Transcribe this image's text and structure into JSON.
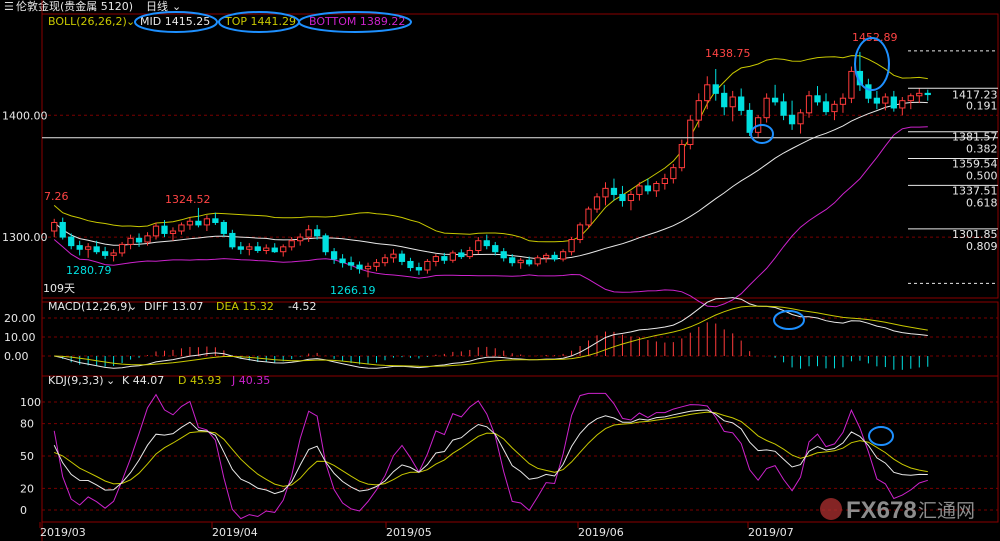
{
  "header": {
    "instrument": "伦敦金现(贵金属 5120)",
    "period": "日线",
    "period_chevron_icon": "chevron-down-icon"
  },
  "colors": {
    "up": "#ff3b3b",
    "down": "#00e0e0",
    "boll_mid": "#e8e8e8",
    "boll_top": "#c8c800",
    "boll_bottom": "#cc22cc",
    "macd_diff": "#e8e8e8",
    "macd_dea": "#c8c800",
    "kdj_k": "#e8e8e8",
    "kdj_d": "#c8c800",
    "kdj_j": "#cc22cc",
    "grid": "#7a0000",
    "highlight": "#1e90ff"
  },
  "boll": {
    "label": "BOLL(26,26,2)",
    "mid": "MID 1415.25",
    "top": "TOP 1441.29",
    "bottom": "BOTTOM 1389.22"
  },
  "macd": {
    "label": "MACD(12,26,9)",
    "diff": "DIFF 13.07",
    "dea": "DEA 15.32",
    "macd": "-4.52"
  },
  "kdj": {
    "label": "KDJ(9,3,3)",
    "k": "K 44.07",
    "d": "D 45.93",
    "j": "J 40.35"
  },
  "price_axis": {
    "labels": [
      "1400.00",
      "1300.00"
    ]
  },
  "fib_levels": [
    {
      "price": "1381.57",
      "ratio": "0.382"
    },
    {
      "price": "1359.54",
      "ratio": "0.500"
    },
    {
      "price": "1337.51",
      "ratio": "0.618"
    },
    {
      "price": "1301.85",
      "ratio": "0.809"
    }
  ],
  "right_labels": {
    "last_price": "1417.23",
    "ratio_top": "0.191"
  },
  "annotations": {
    "a1": "7.26",
    "a2": "1324.52",
    "a3": "1280.79",
    "a4": "1266.19",
    "a5": "1438.75",
    "a6": "1452.89",
    "days": "109天"
  },
  "macd_axis": [
    "20.00",
    "10.00",
    "0.00"
  ],
  "kdj_axis": [
    "100",
    "80",
    "50",
    "20",
    "0"
  ],
  "x_axis": [
    "2019/03",
    "2019/04",
    "2019/05",
    "2019/06",
    "2019/07"
  ],
  "watermark": {
    "brand": "FX678",
    "cn": "汇通网"
  },
  "chart_data": {
    "type": "candlestick",
    "instrument": "伦敦金现",
    "period": "日线",
    "x_ticks": [
      "2019/03",
      "2019/04",
      "2019/05",
      "2019/06",
      "2019/07"
    ],
    "candles": [
      [
        1305,
        1315,
        1300,
        1312
      ],
      [
        1312,
        1316,
        1298,
        1300
      ],
      [
        1300,
        1303,
        1290,
        1293
      ],
      [
        1293,
        1297,
        1285,
        1290
      ],
      [
        1290,
        1295,
        1283,
        1292
      ],
      [
        1292,
        1297,
        1286,
        1288
      ],
      [
        1288,
        1292,
        1282,
        1285
      ],
      [
        1285,
        1290,
        1280,
        1287
      ],
      [
        1287,
        1296,
        1284,
        1294
      ],
      [
        1294,
        1302,
        1290,
        1299
      ],
      [
        1299,
        1303,
        1292,
        1296
      ],
      [
        1296,
        1304,
        1293,
        1301
      ],
      [
        1301,
        1312,
        1298,
        1309
      ],
      [
        1309,
        1314,
        1300,
        1303
      ],
      [
        1303,
        1308,
        1297,
        1305
      ],
      [
        1305,
        1312,
        1302,
        1310
      ],
      [
        1310,
        1316,
        1306,
        1313
      ],
      [
        1313,
        1324,
        1308,
        1310
      ],
      [
        1310,
        1318,
        1305,
        1315
      ],
      [
        1315,
        1320,
        1310,
        1312
      ],
      [
        1312,
        1314,
        1300,
        1303
      ],
      [
        1303,
        1306,
        1290,
        1292
      ],
      [
        1292,
        1296,
        1286,
        1290
      ],
      [
        1290,
        1295,
        1285,
        1292
      ],
      [
        1292,
        1296,
        1287,
        1289
      ],
      [
        1289,
        1294,
        1286,
        1291
      ],
      [
        1291,
        1295,
        1287,
        1288
      ],
      [
        1288,
        1294,
        1284,
        1292
      ],
      [
        1292,
        1300,
        1289,
        1297
      ],
      [
        1297,
        1303,
        1293,
        1300
      ],
      [
        1300,
        1310,
        1296,
        1306
      ],
      [
        1306,
        1310,
        1298,
        1301
      ],
      [
        1301,
        1303,
        1285,
        1288
      ],
      [
        1288,
        1291,
        1278,
        1282
      ],
      [
        1282,
        1286,
        1275,
        1279
      ],
      [
        1279,
        1284,
        1273,
        1277
      ],
      [
        1277,
        1280,
        1270,
        1274
      ],
      [
        1274,
        1279,
        1267,
        1276
      ],
      [
        1276,
        1282,
        1272,
        1279
      ],
      [
        1279,
        1286,
        1276,
        1283
      ],
      [
        1283,
        1290,
        1279,
        1286
      ],
      [
        1286,
        1289,
        1277,
        1280
      ],
      [
        1280,
        1283,
        1272,
        1275
      ],
      [
        1275,
        1279,
        1269,
        1273
      ],
      [
        1273,
        1282,
        1270,
        1280
      ],
      [
        1280,
        1286,
        1276,
        1284
      ],
      [
        1284,
        1287,
        1278,
        1281
      ],
      [
        1281,
        1289,
        1279,
        1287
      ],
      [
        1287,
        1290,
        1282,
        1284
      ],
      [
        1284,
        1292,
        1282,
        1289
      ],
      [
        1289,
        1300,
        1286,
        1297
      ],
      [
        1297,
        1302,
        1290,
        1293
      ],
      [
        1293,
        1296,
        1285,
        1288
      ],
      [
        1288,
        1291,
        1280,
        1283
      ],
      [
        1283,
        1286,
        1276,
        1279
      ],
      [
        1279,
        1283,
        1274,
        1281
      ],
      [
        1281,
        1284,
        1276,
        1278
      ],
      [
        1278,
        1285,
        1276,
        1283
      ],
      [
        1283,
        1287,
        1279,
        1285
      ],
      [
        1285,
        1288,
        1280,
        1282
      ],
      [
        1282,
        1290,
        1280,
        1288
      ],
      [
        1288,
        1300,
        1285,
        1298
      ],
      [
        1298,
        1312,
        1295,
        1310
      ],
      [
        1310,
        1325,
        1307,
        1323
      ],
      [
        1323,
        1336,
        1320,
        1333
      ],
      [
        1333,
        1345,
        1326,
        1340
      ],
      [
        1340,
        1348,
        1330,
        1335
      ],
      [
        1335,
        1342,
        1325,
        1330
      ],
      [
        1330,
        1338,
        1322,
        1335
      ],
      [
        1335,
        1345,
        1330,
        1342
      ],
      [
        1342,
        1348,
        1335,
        1338
      ],
      [
        1338,
        1346,
        1333,
        1344
      ],
      [
        1344,
        1352,
        1339,
        1348
      ],
      [
        1348,
        1360,
        1344,
        1357
      ],
      [
        1357,
        1380,
        1354,
        1376
      ],
      [
        1376,
        1400,
        1372,
        1396
      ],
      [
        1396,
        1418,
        1390,
        1412
      ],
      [
        1412,
        1432,
        1405,
        1425
      ],
      [
        1425,
        1438,
        1412,
        1418
      ],
      [
        1418,
        1425,
        1400,
        1407
      ],
      [
        1407,
        1420,
        1395,
        1415
      ],
      [
        1415,
        1422,
        1400,
        1404
      ],
      [
        1404,
        1410,
        1383,
        1386
      ],
      [
        1386,
        1400,
        1382,
        1398
      ],
      [
        1398,
        1418,
        1394,
        1414
      ],
      [
        1414,
        1425,
        1408,
        1411
      ],
      [
        1411,
        1418,
        1396,
        1400
      ],
      [
        1400,
        1412,
        1388,
        1393
      ],
      [
        1393,
        1405,
        1385,
        1402
      ],
      [
        1402,
        1420,
        1398,
        1416
      ],
      [
        1416,
        1424,
        1408,
        1411
      ],
      [
        1411,
        1418,
        1400,
        1403
      ],
      [
        1403,
        1412,
        1396,
        1409
      ],
      [
        1409,
        1418,
        1402,
        1414
      ],
      [
        1414,
        1440,
        1410,
        1436
      ],
      [
        1436,
        1452,
        1420,
        1425
      ],
      [
        1425,
        1430,
        1410,
        1414
      ],
      [
        1414,
        1420,
        1405,
        1410
      ],
      [
        1410,
        1418,
        1404,
        1415
      ],
      [
        1415,
        1420,
        1403,
        1406
      ],
      [
        1406,
        1415,
        1400,
        1412
      ],
      [
        1412,
        1418,
        1405,
        1416
      ],
      [
        1416,
        1422,
        1410,
        1418
      ],
      [
        1418,
        1421,
        1412,
        1417
      ]
    ]
  }
}
